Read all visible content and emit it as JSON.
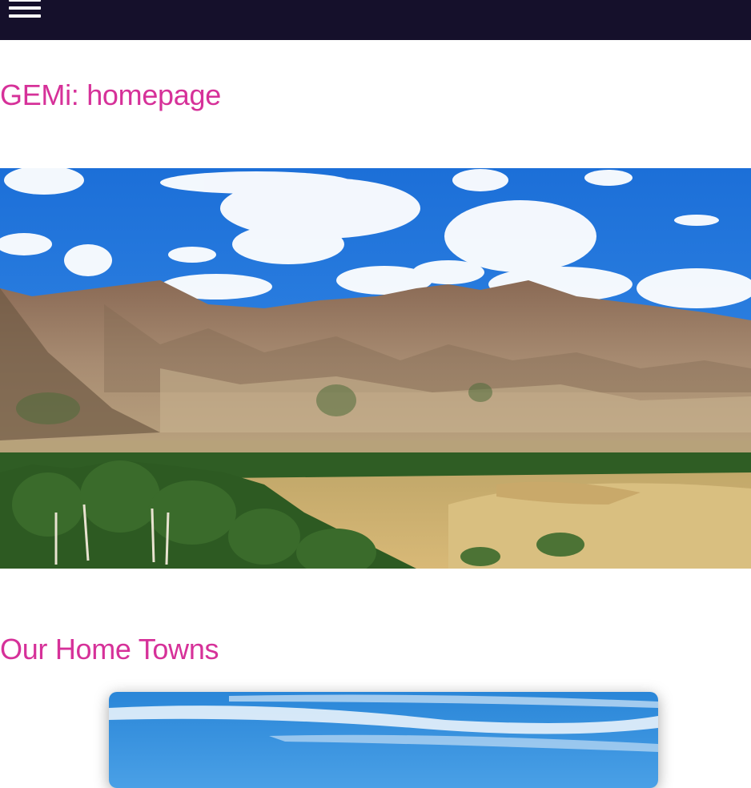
{
  "header": {
    "menu_icon": "hamburger-menu-icon"
  },
  "page": {
    "title": "GEMi: homepage"
  },
  "sections": {
    "home_towns_title": "Our Home Towns"
  },
  "images": {
    "hero": "mountain-valley-landscape-image",
    "town_card": "sky-landscape-image"
  },
  "colors": {
    "header_bg": "#15102b",
    "heading": "#d63199",
    "background": "#ffffff"
  }
}
